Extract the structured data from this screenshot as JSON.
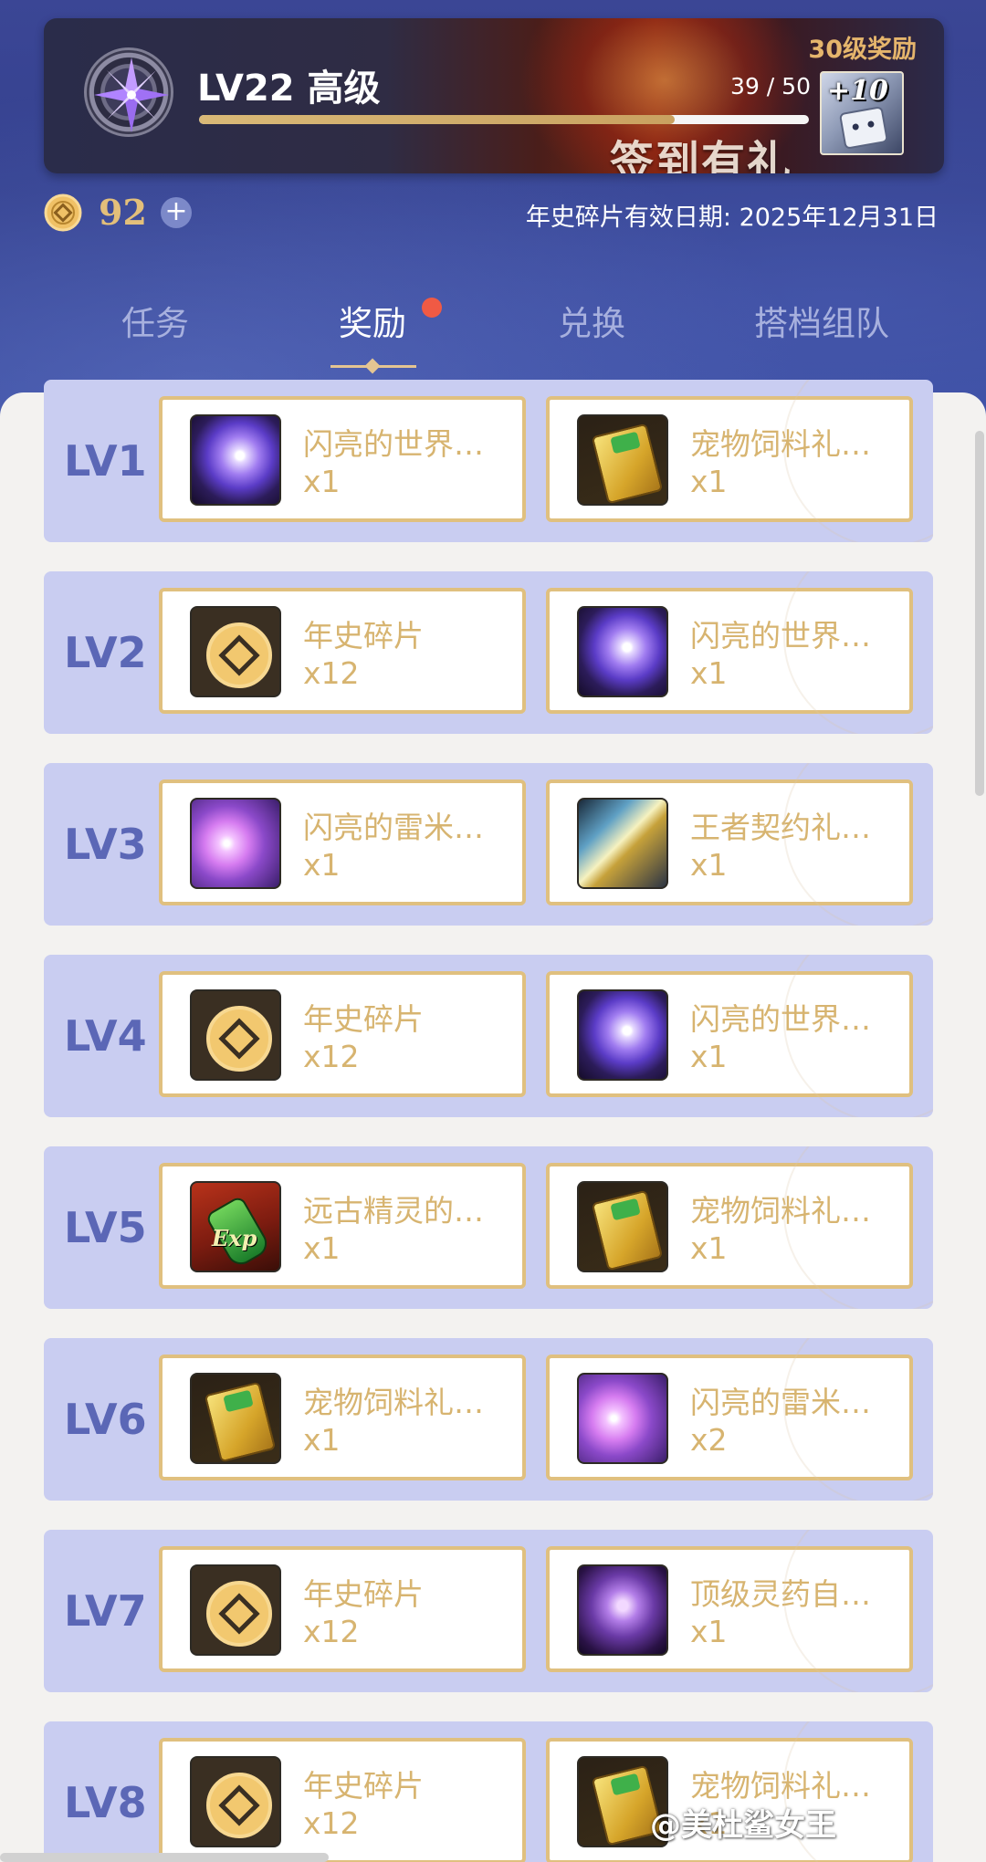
{
  "header": {
    "level_title": "LV22 高级",
    "progress_text": "39 / 50",
    "progress_fraction": 0.78,
    "reward_label": "30级奖励",
    "reward_badge": "+10",
    "banner_art_text": "签到有礼",
    "coin_value": "92",
    "coin_plus": "+",
    "validity": "年史碎片有效日期: 2025年12月31日"
  },
  "tabs": [
    {
      "label": "任务",
      "active": false
    },
    {
      "label": "奖励",
      "active": true,
      "has_badge": true
    },
    {
      "label": "兑换",
      "active": false
    },
    {
      "label": "搭档组队",
      "active": false
    }
  ],
  "rows": [
    {
      "level": "LV1",
      "items": [
        {
          "name": "闪亮的世界…",
          "qty": "x1",
          "icon": "world-orb-icon"
        },
        {
          "name": "宠物饲料礼…",
          "qty": "x1",
          "icon": "pet-food-gift-icon"
        }
      ]
    },
    {
      "level": "LV2",
      "items": [
        {
          "name": "年史碎片",
          "qty": "x12",
          "icon": "chronicle-shard-icon"
        },
        {
          "name": "闪亮的世界…",
          "qty": "x1",
          "icon": "world-orb-icon"
        }
      ]
    },
    {
      "level": "LV3",
      "items": [
        {
          "name": "闪亮的雷米…",
          "qty": "x1",
          "icon": "remy-crystal-icon"
        },
        {
          "name": "王者契约礼…",
          "qty": "x1",
          "icon": "king-contract-gift-icon"
        }
      ]
    },
    {
      "level": "LV4",
      "items": [
        {
          "name": "年史碎片",
          "qty": "x12",
          "icon": "chronicle-shard-icon"
        },
        {
          "name": "闪亮的世界…",
          "qty": "x1",
          "icon": "world-orb-icon"
        }
      ]
    },
    {
      "level": "LV5",
      "items": [
        {
          "name": "远古精灵的…",
          "qty": "x1",
          "icon": "exp-potion-icon"
        },
        {
          "name": "宠物饲料礼…",
          "qty": "x1",
          "icon": "pet-food-gift-icon"
        }
      ]
    },
    {
      "level": "LV6",
      "items": [
        {
          "name": "宠物饲料礼…",
          "qty": "x1",
          "icon": "pet-food-gift-icon"
        },
        {
          "name": "闪亮的雷米…",
          "qty": "x2",
          "icon": "remy-crystal-icon"
        }
      ]
    },
    {
      "level": "LV7",
      "items": [
        {
          "name": "年史碎片",
          "qty": "x12",
          "icon": "chronicle-shard-icon"
        },
        {
          "name": "顶级灵药自…",
          "qty": "x1",
          "icon": "elixir-chest-icon"
        }
      ]
    },
    {
      "level": "LV8",
      "items": [
        {
          "name": "年史碎片",
          "qty": "x12",
          "icon": "chronicle-shard-icon"
        },
        {
          "name": "宠物饲料礼…",
          "qty": "x1",
          "icon": "pet-food-gift-icon"
        }
      ]
    }
  ],
  "watermark": "@美杜鲨女王",
  "colors": {
    "accent_gold": "#d7b470",
    "row_bg": "#c9cdf1",
    "level_text": "#5b67b6",
    "header_bg": "#34418f",
    "badge_red": "#f05a44"
  }
}
